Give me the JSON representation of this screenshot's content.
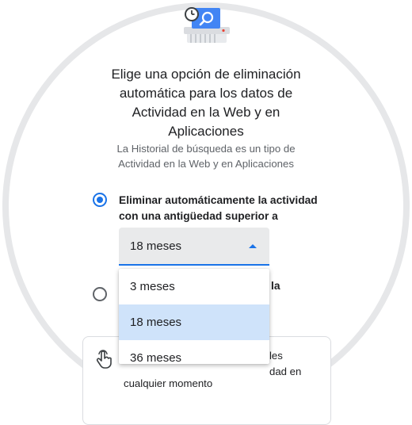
{
  "dialog": {
    "heading_lines": [
      "Elige una opción de eliminación",
      "automática para los datos de",
      "Actividad en la Web y en",
      "Aplicaciones"
    ],
    "subtext_lines": [
      "La Historial de búsqueda es un tipo de",
      "Actividad en la Web y en Aplicaciones"
    ]
  },
  "options": {
    "auto_delete": {
      "checked": true,
      "label_lines": [
        "Eliminar automáticamente la actividad",
        "con una antigüedad superior a"
      ]
    },
    "second_option": {
      "checked": false,
      "partial_label": "la"
    }
  },
  "select": {
    "value": "18 meses",
    "options": [
      "3 meses",
      "18 meses",
      "36 meses"
    ],
    "selected_index": 1
  },
  "info_card": {
    "text_lines": [
      "les",
      "dad en"
    ],
    "bottom_text": "cualquier momento"
  },
  "colors": {
    "accent": "#1a73e8",
    "selected_option_bg": "#cfe3fa",
    "select_bg": "#e9eaeb"
  }
}
